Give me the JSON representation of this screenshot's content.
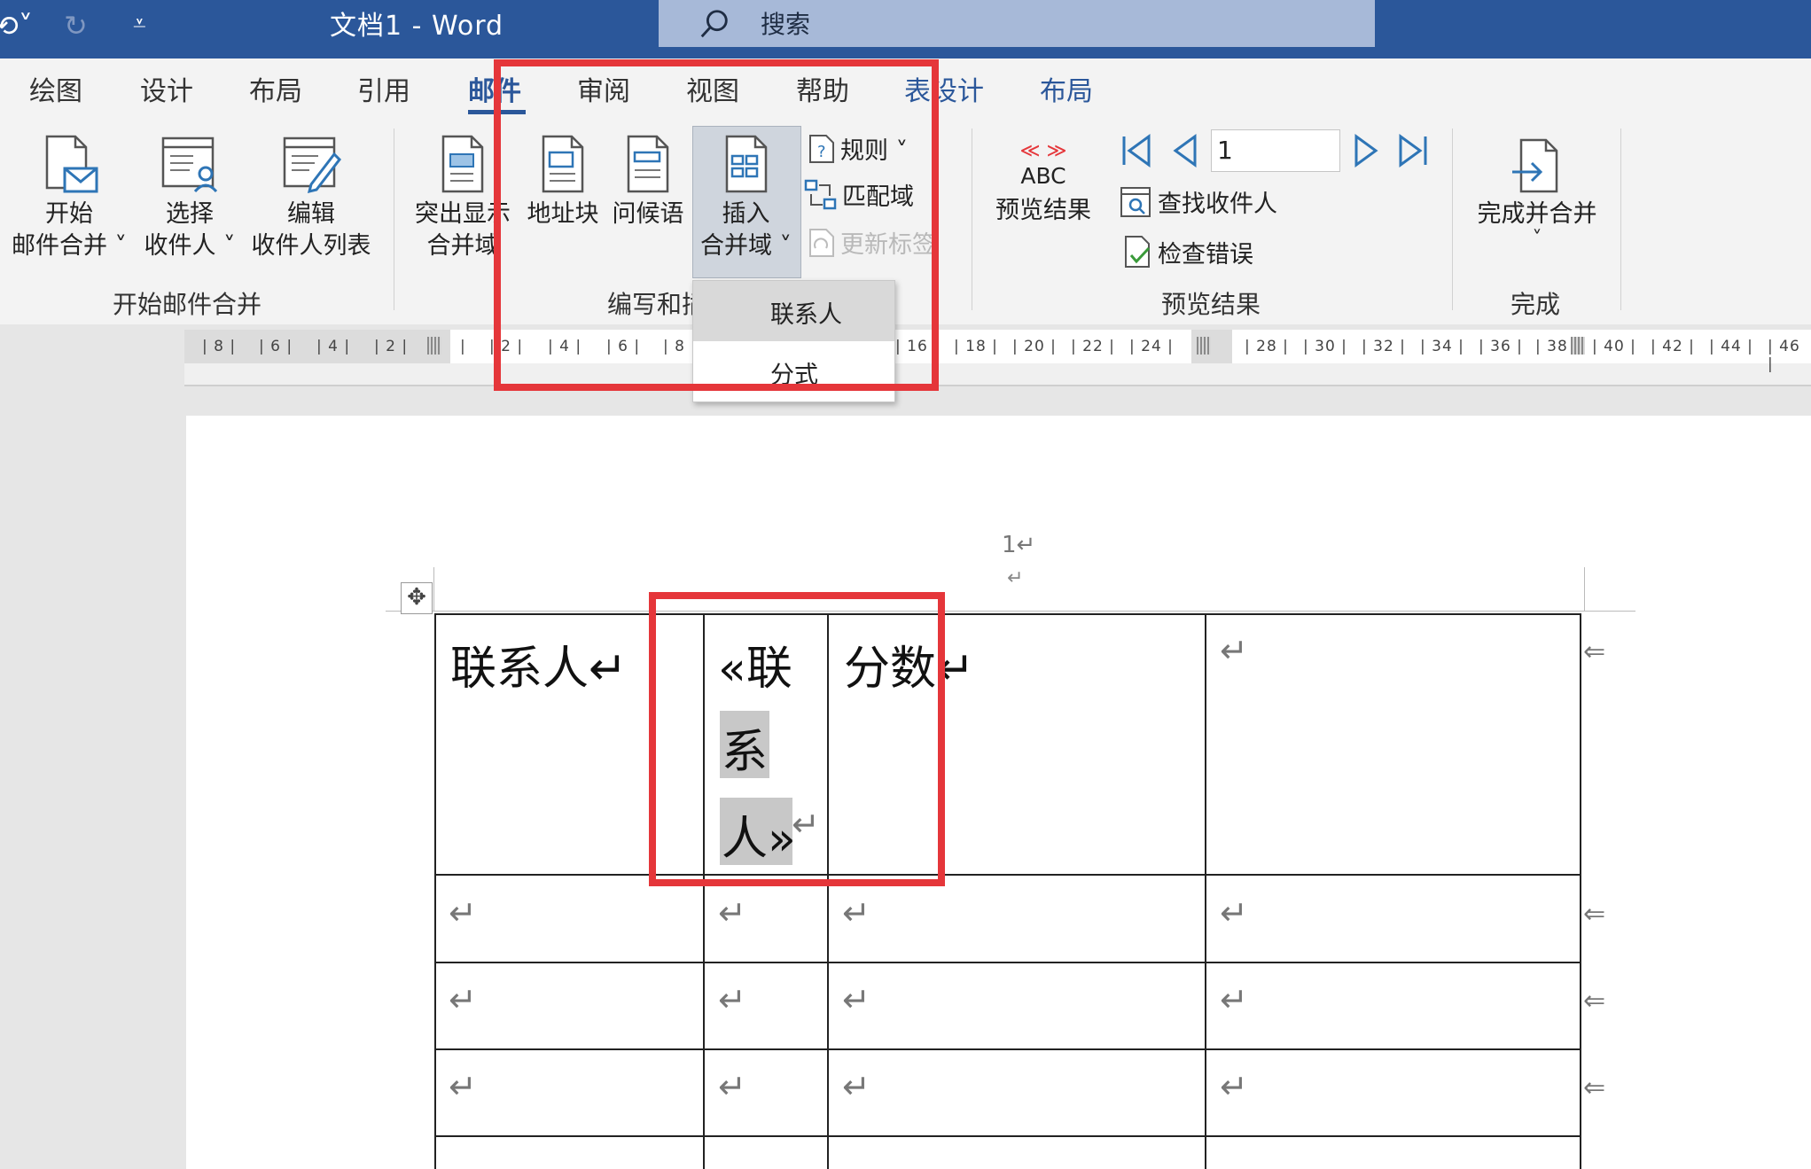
{
  "window": {
    "title": "文档1  -  Word",
    "search_placeholder": "搜索"
  },
  "tabs": [
    {
      "label": "绘图"
    },
    {
      "label": "设计"
    },
    {
      "label": "布局"
    },
    {
      "label": "引用"
    },
    {
      "label": "邮件",
      "active": true
    },
    {
      "label": "审阅"
    },
    {
      "label": "视图"
    },
    {
      "label": "帮助"
    },
    {
      "label": "表设计",
      "context": true
    },
    {
      "label": "布局",
      "context": true
    }
  ],
  "ribbon": {
    "start_group": {
      "label": "开始邮件合并",
      "start_merge": [
        "开始",
        "邮件合并 ˅"
      ],
      "select_recipients": [
        "选择",
        "收件人 ˅"
      ],
      "edit_recipients": [
        "编辑",
        "收件人列表"
      ]
    },
    "write_group": {
      "label": "编写和插入域",
      "highlight_fields": [
        "突出显示",
        "合并域"
      ],
      "address_block": "地址块",
      "greeting_line": "问候语",
      "insert_merge_field": [
        "插入",
        "合并域 ˅"
      ],
      "rules": "规则 ˅",
      "match_fields": "匹配域",
      "update_labels": "更新标签"
    },
    "preview_group": {
      "label": "预览结果",
      "preview_results": [
        "ABC",
        "预览结果"
      ],
      "record_number": "1",
      "find_recipient": "查找收件人",
      "check_errors": "检查错误"
    },
    "finish_group": {
      "label": "完成",
      "finish_merge": [
        "完成并合并",
        "˅"
      ]
    }
  },
  "ruler": {
    "left_labels": [
      "8",
      "6",
      "4",
      "2"
    ],
    "right_labels": [
      "2",
      "4",
      "6",
      "8",
      "16",
      "18",
      "20",
      "22",
      "24",
      "28",
      "30",
      "32",
      "34",
      "36",
      "38",
      "40",
      "42",
      "44",
      "46"
    ]
  },
  "dropdown": {
    "items": [
      "联系人",
      "分式"
    ]
  },
  "document": {
    "page_number": "1↵",
    "header_return": "↵",
    "cell_1": "联系人↵",
    "field_open": "«联",
    "field_mid": "系",
    "field_end": "人»",
    "field_return": "↵",
    "cell_3": "分数↵",
    "return_mark": "↵",
    "row_end_mark": "⇐"
  },
  "colors": {
    "title_bar": "#2b579a",
    "accent": "#2b579a",
    "highlight_box": "#e5363a"
  }
}
